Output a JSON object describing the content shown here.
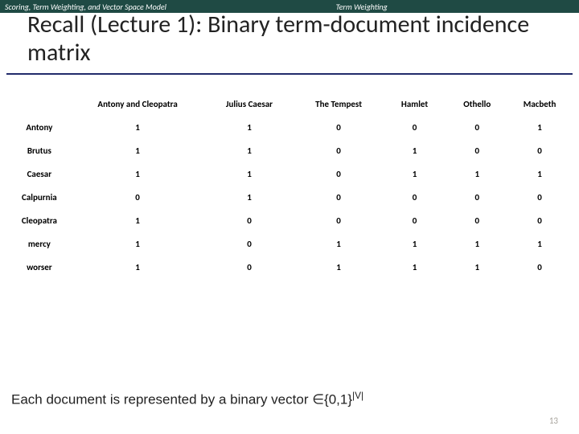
{
  "top": {
    "left": "Scoring, Term Weighting, and Vector Space Model",
    "right": "Term Weighting"
  },
  "title": "Recall (Lecture 1): Binary term-document incidence matrix",
  "chart_data": {
    "type": "table",
    "title": "Binary term-document incidence matrix",
    "columns": [
      "Antony and Cleopatra",
      "Julius Caesar",
      "The Tempest",
      "Hamlet",
      "Othello",
      "Macbeth"
    ],
    "rows": [
      "Antony",
      "Brutus",
      "Caesar",
      "Calpurnia",
      "Cleopatra",
      "mercy",
      "worser"
    ],
    "values": [
      [
        1,
        1,
        0,
        0,
        0,
        1
      ],
      [
        1,
        1,
        0,
        1,
        0,
        0
      ],
      [
        1,
        1,
        0,
        1,
        1,
        1
      ],
      [
        0,
        1,
        0,
        0,
        0,
        0
      ],
      [
        1,
        0,
        0,
        0,
        0,
        0
      ],
      [
        1,
        0,
        1,
        1,
        1,
        1
      ],
      [
        1,
        0,
        1,
        1,
        1,
        0
      ]
    ]
  },
  "footer": {
    "prefix": "Each document is represented by a binary vector ",
    "in": "∈",
    "set": "{0,1}",
    "sup": "|V|"
  },
  "page": "13"
}
